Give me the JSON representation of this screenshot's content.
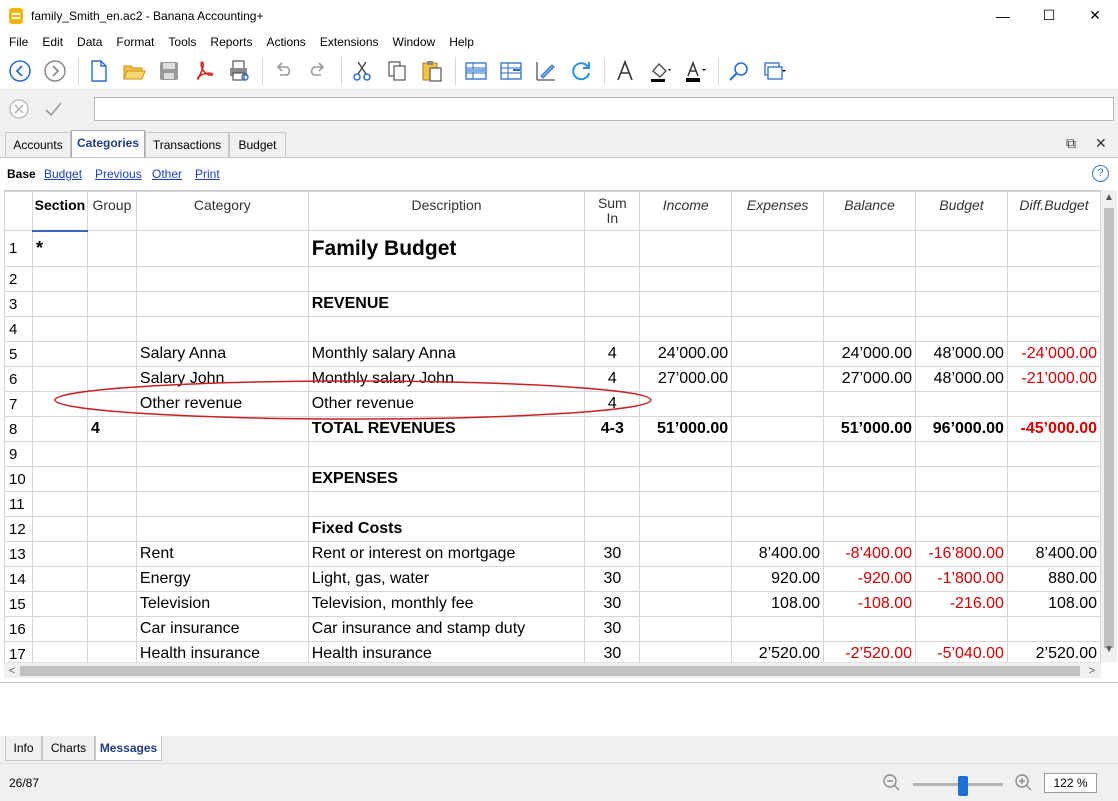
{
  "window": {
    "title": "family_Smith_en.ac2 - Banana Accounting+",
    "minimize": "—",
    "maximize": "☐",
    "close": "✕"
  },
  "menu": [
    "File",
    "Edit",
    "Data",
    "Format",
    "Tools",
    "Reports",
    "Actions",
    "Extensions",
    "Window",
    "Help"
  ],
  "toolbar": {
    "icons": [
      "back-icon",
      "forward-icon",
      "new-file-icon",
      "open-folder-icon",
      "save-icon",
      "pdf-icon",
      "print-preview-icon",
      "undo-icon",
      "redo-icon",
      "cut-icon",
      "copy-icon",
      "paste-icon",
      "add-row-icon",
      "insert-rows-icon",
      "edit-icon",
      "recalculate-icon",
      "font-icon",
      "fill-color-icon",
      "text-color-icon",
      "search-icon",
      "window-icon"
    ]
  },
  "formula_bar": {
    "value": ""
  },
  "table_tabs": [
    "Accounts",
    "Categories",
    "Transactions",
    "Budget"
  ],
  "active_table_tab": "Categories",
  "views": [
    "Base",
    "Budget",
    "Previous",
    "Other",
    "Print"
  ],
  "active_view": "Base",
  "columns": [
    "Section",
    "Group",
    "Category",
    "Description",
    "Sum",
    "In",
    "Income",
    "Expenses",
    "Balance",
    "Budget",
    "Diff.Budget"
  ],
  "rows": [
    {
      "n": "1",
      "section": "*",
      "group": "",
      "category": "",
      "description": "Family Budget",
      "sumin": "",
      "income": "",
      "expenses": "",
      "balance": "",
      "budget": "",
      "diff": ""
    },
    {
      "n": "2",
      "section": "",
      "group": "",
      "category": "",
      "description": "",
      "sumin": "",
      "income": "",
      "expenses": "",
      "balance": "",
      "budget": "",
      "diff": ""
    },
    {
      "n": "3",
      "section": "",
      "group": "",
      "category": "",
      "description": "REVENUE",
      "sumin": "",
      "income": "",
      "expenses": "",
      "balance": "",
      "budget": "",
      "diff": ""
    },
    {
      "n": "4",
      "section": "",
      "group": "",
      "category": "",
      "description": "",
      "sumin": "",
      "income": "",
      "expenses": "",
      "balance": "",
      "budget": "",
      "diff": ""
    },
    {
      "n": "5",
      "section": "",
      "group": "",
      "category": "Salary Anna",
      "description": "Monthly salary Anna",
      "sumin": "4",
      "income": "24’000.00",
      "expenses": "",
      "balance": "24’000.00",
      "budget": "48’000.00",
      "diff": "-24’000.00"
    },
    {
      "n": "6",
      "section": "",
      "group": "",
      "category": "Salary John",
      "description": "Monthly salary John",
      "sumin": "4",
      "income": "27’000.00",
      "expenses": "",
      "balance": "27’000.00",
      "budget": "48’000.00",
      "diff": "-21’000.00"
    },
    {
      "n": "7",
      "section": "",
      "group": "",
      "category": "Other revenue",
      "description": "Other revenue",
      "sumin": "4",
      "income": "",
      "expenses": "",
      "balance": "",
      "budget": "",
      "diff": ""
    },
    {
      "n": "8",
      "section": "",
      "group": "4",
      "category": "",
      "description": "TOTAL REVENUES",
      "sumin": "4-3",
      "income": "51’000.00",
      "expenses": "",
      "balance": "51’000.00",
      "budget": "96’000.00",
      "diff": "-45’000.00"
    },
    {
      "n": "9",
      "section": "",
      "group": "",
      "category": "",
      "description": "",
      "sumin": "",
      "income": "",
      "expenses": "",
      "balance": "",
      "budget": "",
      "diff": ""
    },
    {
      "n": "10",
      "section": "",
      "group": "",
      "category": "",
      "description": "EXPENSES",
      "sumin": "",
      "income": "",
      "expenses": "",
      "balance": "",
      "budget": "",
      "diff": ""
    },
    {
      "n": "11",
      "section": "",
      "group": "",
      "category": "",
      "description": "",
      "sumin": "",
      "income": "",
      "expenses": "",
      "balance": "",
      "budget": "",
      "diff": ""
    },
    {
      "n": "12",
      "section": "",
      "group": "",
      "category": "",
      "description": "Fixed Costs",
      "sumin": "",
      "income": "",
      "expenses": "",
      "balance": "",
      "budget": "",
      "diff": ""
    },
    {
      "n": "13",
      "section": "",
      "group": "",
      "category": "Rent",
      "description": "Rent or interest on mortgage",
      "sumin": "30",
      "income": "",
      "expenses": "8’400.00",
      "balance": "-8’400.00",
      "budget": "-16’800.00",
      "diff": "8’400.00"
    },
    {
      "n": "14",
      "section": "",
      "group": "",
      "category": "Energy",
      "description": "Light, gas, water",
      "sumin": "30",
      "income": "",
      "expenses": "920.00",
      "balance": "-920.00",
      "budget": "-1’800.00",
      "diff": "880.00"
    },
    {
      "n": "15",
      "section": "",
      "group": "",
      "category": "Television",
      "description": "Television, monthly fee",
      "sumin": "30",
      "income": "",
      "expenses": "108.00",
      "balance": "-108.00",
      "budget": "-216.00",
      "diff": "108.00"
    },
    {
      "n": "16",
      "section": "",
      "group": "",
      "category": "Car insurance",
      "description": "Car insurance and stamp duty",
      "sumin": "30",
      "income": "",
      "expenses": "",
      "balance": "",
      "budget": "",
      "diff": ""
    },
    {
      "n": "17",
      "section": "",
      "group": "",
      "category": "Health insurance",
      "description": "Health insurance",
      "sumin": "30",
      "income": "",
      "expenses": "2’520.00",
      "balance": "-2’520.00",
      "budget": "-5’040.00",
      "diff": "2’520.00"
    }
  ],
  "bottom_tabs": [
    "Info",
    "Charts",
    "Messages"
  ],
  "active_bottom_tab": "Messages",
  "status": {
    "position": "26/87",
    "zoom": "122 %",
    "zoom_level": 0.55
  },
  "colors": {
    "negative": "#d10000",
    "active_tab_text": "#1f3b8a",
    "link": "#1a40c4",
    "annotation": "#cc2020"
  }
}
